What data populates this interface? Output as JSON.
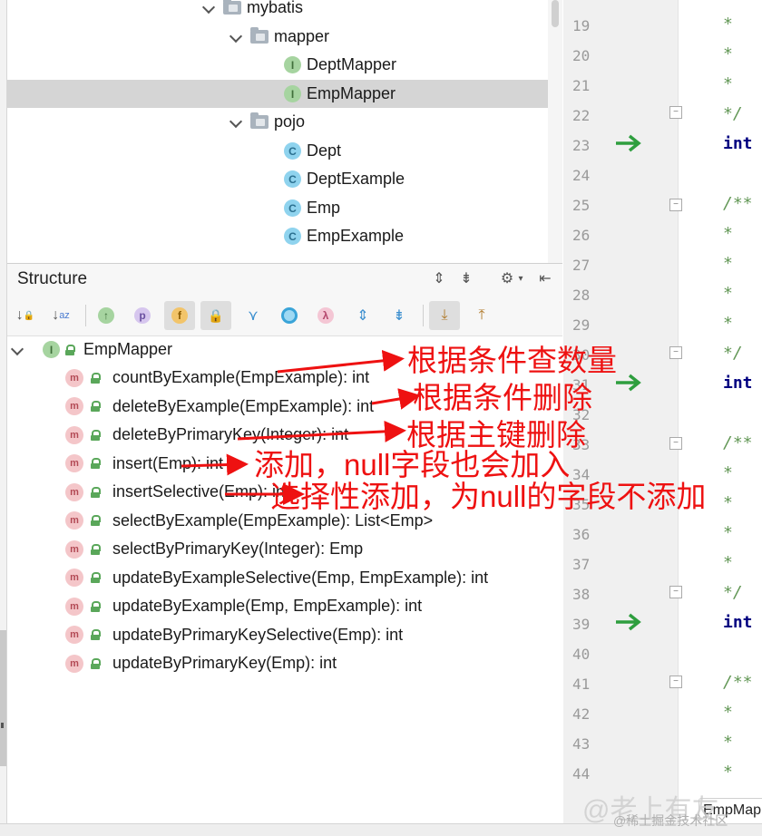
{
  "project_tree": {
    "items": [
      {
        "label": "mybatis",
        "kind": "folder",
        "expanded": true
      },
      {
        "label": "mapper",
        "kind": "folder",
        "expanded": true
      },
      {
        "label": "DeptMapper",
        "kind": "interface",
        "icon_letter": "I"
      },
      {
        "label": "EmpMapper",
        "kind": "interface",
        "icon_letter": "I",
        "selected": true
      },
      {
        "label": "pojo",
        "kind": "folder",
        "expanded": true
      },
      {
        "label": "Dept",
        "kind": "class",
        "icon_letter": "C"
      },
      {
        "label": "DeptExample",
        "kind": "class",
        "icon_letter": "C"
      },
      {
        "label": "Emp",
        "kind": "class",
        "icon_letter": "C"
      },
      {
        "label": "EmpExample",
        "kind": "class",
        "icon_letter": "C"
      }
    ]
  },
  "structure": {
    "title": "Structure",
    "toolbar_letters": {
      "property": "p",
      "field": "f",
      "lambda": "λ"
    },
    "root": {
      "label": "EmpMapper",
      "icon_letter": "I"
    },
    "method_icon_letter": "m",
    "methods": [
      "countByExample(EmpExample): int",
      "deleteByExample(EmpExample): int",
      "deleteByPrimaryKey(Integer): int",
      "insert(Emp): int",
      "insertSelective(Emp): int",
      "selectByExample(EmpExample): List<Emp>",
      "selectByPrimaryKey(Integer): Emp",
      "updateByExampleSelective(Emp, EmpExample): int",
      "updateByExample(Emp, EmpExample): int",
      "updateByPrimaryKeySelective(Emp): int",
      "updateByPrimaryKey(Emp): int"
    ]
  },
  "editor": {
    "line_numbers": [
      "19",
      "20",
      "21",
      "22",
      "23",
      "24",
      "25",
      "26",
      "27",
      "28",
      "29",
      "30",
      "31",
      "32",
      "33",
      "34",
      "35",
      "36",
      "37",
      "38",
      "39",
      "40",
      "41",
      "42",
      "43",
      "44"
    ],
    "tab_label": "EmpMapp"
  },
  "annotations": [
    "根据条件查数量",
    "根据条件删除",
    "根据主键删除",
    "添加，null字段也会加入",
    "选择性添加，为null的字段不添加"
  ],
  "watermark": {
    "text": "@稀土掘金技术社区",
    "big_text": "@老上有友"
  },
  "colors": {
    "annotation_red": "#ee1111",
    "selection_bg": "#d5d5d5",
    "run_arrow_green": "#2e9e3e",
    "comment_green": "#629755"
  }
}
